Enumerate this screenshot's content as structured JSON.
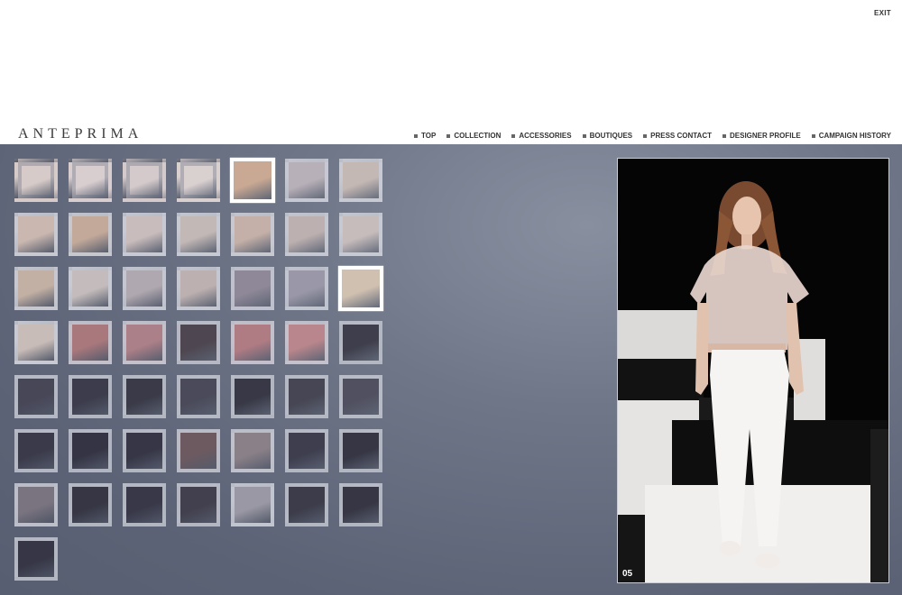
{
  "header": {
    "exit_label": "EXIT",
    "logo": "ANTEPRIMA",
    "nav": [
      "TOP",
      "COLLECTION",
      "ACCESSORIES",
      "BOUTIQUES",
      "PRESS CONTACT",
      "DESIGNER PROFILE",
      "CAMPAIGN HISTORY"
    ]
  },
  "viewer": {
    "counter": "05"
  },
  "thumbnails": [
    {
      "color": "#d6cbc8",
      "style": "plain"
    },
    {
      "color": "#d8ced0",
      "style": "plain"
    },
    {
      "color": "#d4cacb",
      "style": "plain"
    },
    {
      "color": "#d9d0d0",
      "style": "plain"
    },
    {
      "color": "#c9a993",
      "style": "active"
    },
    {
      "color": "#b8b0b8",
      "style": "border"
    },
    {
      "color": "#c4b8b4",
      "style": "border"
    },
    {
      "color": "#c9b7b0",
      "style": "border"
    },
    {
      "color": "#c2a99a",
      "style": "border"
    },
    {
      "color": "#c8bcbc",
      "style": "border"
    },
    {
      "color": "#c2b8b6",
      "style": "border"
    },
    {
      "color": "#c4b0a8",
      "style": "border"
    },
    {
      "color": "#bcb0b0",
      "style": "border"
    },
    {
      "color": "#c6bcbc",
      "style": "border"
    },
    {
      "color": "#c2b0a4",
      "style": "border"
    },
    {
      "color": "#c4bcbc",
      "style": "border"
    },
    {
      "color": "#b0a8b0",
      "style": "border"
    },
    {
      "color": "#bcb0b0",
      "style": "border"
    },
    {
      "color": "#8e8898",
      "style": "border"
    },
    {
      "color": "#9a98a8",
      "style": "border"
    },
    {
      "color": "#d0c0b0",
      "style": "active"
    },
    {
      "color": "#c8bcb8",
      "style": "border"
    },
    {
      "color": "#a8787c",
      "style": "border"
    },
    {
      "color": "#ac8088",
      "style": "border"
    },
    {
      "color": "#4e4650",
      "style": "border"
    },
    {
      "color": "#b07c84",
      "style": "border"
    },
    {
      "color": "#b8868c",
      "style": "border"
    },
    {
      "color": "#3e3e4c",
      "style": "border"
    },
    {
      "color": "#474758",
      "style": "border"
    },
    {
      "color": "#3c3c4c",
      "style": "border"
    },
    {
      "color": "#3a3a48",
      "style": "border"
    },
    {
      "color": "#4a4a5a",
      "style": "border"
    },
    {
      "color": "#383846",
      "style": "border"
    },
    {
      "color": "#464654",
      "style": "border"
    },
    {
      "color": "#505060",
      "style": "border"
    },
    {
      "color": "#3a3a4a",
      "style": "border"
    },
    {
      "color": "#343444",
      "style": "border"
    },
    {
      "color": "#363646",
      "style": "border"
    },
    {
      "color": "#6c5a60",
      "style": "border"
    },
    {
      "color": "#8a8088",
      "style": "border"
    },
    {
      "color": "#3e3e4e",
      "style": "border"
    },
    {
      "color": "#363644",
      "style": "border"
    },
    {
      "color": "#7a7480",
      "style": "border"
    },
    {
      "color": "#363644",
      "style": "border"
    },
    {
      "color": "#383848",
      "style": "border"
    },
    {
      "color": "#42404e",
      "style": "border"
    },
    {
      "color": "#9a98a4",
      "style": "border"
    },
    {
      "color": "#3c3c4a",
      "style": "border"
    },
    {
      "color": "#363644",
      "style": "border"
    },
    {
      "color": "#363646",
      "style": "border"
    }
  ]
}
